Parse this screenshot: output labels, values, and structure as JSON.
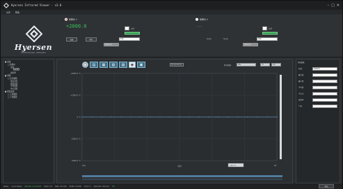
{
  "window": {
    "title": "Hyersen Infrared Viewer - v3.0",
    "controls": [
      "–",
      "□",
      "✕"
    ]
  },
  "menu": [
    "文件",
    "帮助"
  ],
  "brand": {
    "name": "Hyersen",
    "tagline": "PROFESSIONAL INFRARED"
  },
  "camera1": {
    "label": "热像仪 1",
    "temperature": "+2000.0",
    "checkbox_label": "自动",
    "button_a": "连接",
    "button_b": "断开",
    "field_a": "192",
    "field_b": "Network"
  },
  "camera2": {
    "label": "热像仪 2",
    "temperature": "———",
    "checkbox_label": "自动",
    "label_a": "Serial",
    "label_b": "Serial",
    "field_a": "192",
    "field_b": "Network"
  },
  "tree": [
    {
      "level": 0,
      "label": "■ 设备"
    },
    {
      "level": 1,
      "label": "□ 热像仪"
    },
    {
      "level": 2,
      "label": "温度"
    },
    {
      "level": 3,
      "label": "600"
    },
    {
      "level": 2,
      "label": "发射率"
    },
    {
      "level": 0,
      "label": "■ 测量"
    },
    {
      "level": 1,
      "label": "□ 实时曲线"
    },
    {
      "level": 2,
      "label": "最高温度"
    },
    {
      "level": 2,
      "label": "最低温度"
    },
    {
      "level": 2,
      "label": "平均温度"
    },
    {
      "level": 2,
      "label": "中心温度"
    },
    {
      "level": 0,
      "label": "■ 报警设置"
    },
    {
      "level": 1,
      "label": "□ 上限报警"
    },
    {
      "level": 1,
      "label": "□ 下限报警"
    }
  ],
  "toolbar": {
    "icons": [
      "refresh-icon",
      "chart-icon",
      "zoom-in-icon",
      "zoom-out-icon",
      "save-icon",
      "target-icon",
      "export-icon"
    ],
    "glyphs": [
      "◯",
      "▤",
      "▦",
      "▧",
      "▨",
      "◉",
      "▣"
    ],
    "display_field": "Temperature",
    "range_label": "时间范围:",
    "range_value": "60s",
    "unit_value": "°C",
    "unit_field": "0.5"
  },
  "chart_data": {
    "type": "line",
    "series": [
      {
        "values": [
          0,
          0,
          0,
          0,
          0,
          0,
          0,
          0,
          0,
          0,
          0,
          0,
          0,
          0,
          0,
          0,
          0,
          0,
          0,
          0,
          0
        ]
      }
    ],
    "ytick_labels": [
      "+4000.0 ℃",
      "+2000.0 ℃",
      "0 ℃",
      "-2000.0 ℃",
      "-4000.0 ℃"
    ],
    "ylim": [
      -4000,
      4000
    ],
    "xlabel": "时间",
    "x_start_label": "0(s)",
    "x_end_label": "60",
    "cursor_field": "+0.1 ℃"
  },
  "right_panel": {
    "title": "测温参数",
    "rows": [
      {
        "label": "区域:",
        "value": "Default"
      },
      {
        "label": "最大值:",
        "value": ""
      },
      {
        "label": "最小值:",
        "value": ""
      },
      {
        "label": "平均值:",
        "value": ""
      },
      {
        "label": "中心点:",
        "value": ""
      },
      {
        "label": "发射率:",
        "value": ""
      },
      {
        "label": "T 值:",
        "value": ""
      }
    ]
  },
  "status": {
    "items": [
      "Ready",
      "Local: Ready",
      "Remote: Connected",
      "Temp: 0.0",
      "Rate: 25.0 fps",
      "Buffer: 0/1000",
      "Clock: 0",
      "Operation: Monitor",
      "OK"
    ],
    "button": "退出"
  },
  "colors": {
    "accent_green": "#3ac05c",
    "accent_blue": "#3f6f88",
    "line": "#5a8fb8",
    "alarm_red": "#e25b4e"
  }
}
